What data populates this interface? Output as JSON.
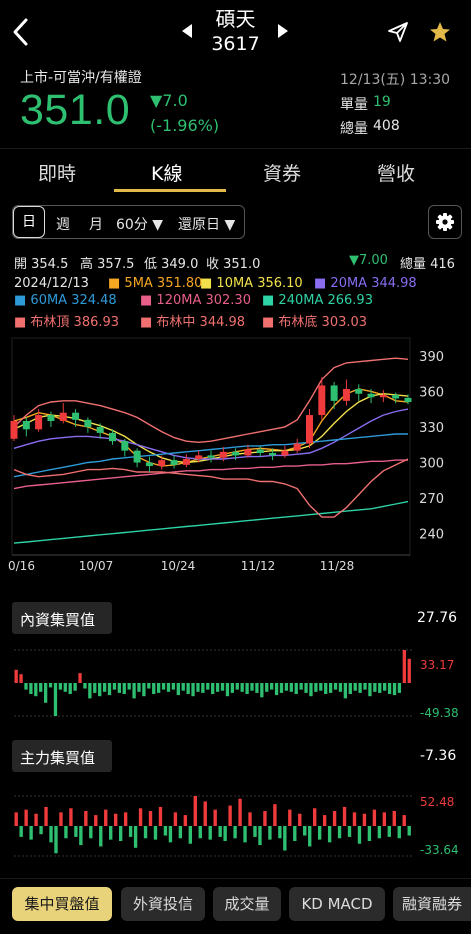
{
  "header": {
    "stock_name": "碩天",
    "stock_code": "3617",
    "market_info": "上市-可當沖/有權證",
    "price": "351.0",
    "change": "▼7.0",
    "change_pct": "(-1.96%)",
    "datetime": "12/13(五) 13:30",
    "unit_volume_label": "單量",
    "unit_volume": "19",
    "total_volume_label": "總量",
    "total_volume": "408"
  },
  "tabs": [
    "即時",
    "K線",
    "資券",
    "營收"
  ],
  "active_tab": "K線",
  "periods": {
    "day": "日",
    "week": "週",
    "month": "月",
    "minute": "60分 ▼",
    "restore": "還原日 ▼"
  },
  "ohlc": {
    "open": "開 354.5",
    "high": "高 357.5",
    "low": "低 349.0",
    "close": "收 351.0",
    "change": "▼7.00",
    "volume": "總量 416"
  },
  "legend": {
    "date": "2024/12/13",
    "ma5": "5MA 351.80",
    "ma10": "10MA 356.10",
    "ma20": "20MA 344.98",
    "ma60": "60MA 324.48",
    "ma120": "120MA 302.30",
    "ma240": "240MA 266.93",
    "bb_upper": "布林頂 386.93",
    "bb_mid": "布林中 344.98",
    "bb_lower": "布林底 303.03"
  },
  "colors": {
    "ma5": "#f5a623",
    "ma10": "#f2e14a",
    "ma20": "#8a6df0",
    "ma60": "#2e9ad8",
    "ma120": "#e8608a",
    "ma240": "#2ed3a6",
    "bb": "#f07070",
    "up": "#ef3b3b",
    "down": "#2fbf71",
    "accent": "#e3b94a"
  },
  "chart_data": {
    "type": "line",
    "y_ticks": [
      390,
      360,
      330,
      300,
      270,
      240
    ],
    "ylim": [
      222,
      405
    ],
    "x_ticks": [
      "0/16",
      "10/07",
      "10/24",
      "11/12",
      "11/28"
    ],
    "series": [
      {
        "name": "5MA",
        "values": [
          335,
          338,
          342,
          340,
          336,
          332,
          330,
          326,
          322,
          315,
          305,
          300,
          297,
          298,
          300,
          303,
          305,
          307,
          309,
          311,
          312,
          311,
          310,
          313,
          318,
          335,
          348,
          358,
          362,
          360,
          357,
          352,
          351
        ]
      },
      {
        "name": "10MA",
        "values": [
          328,
          333,
          338,
          340,
          339,
          337,
          334,
          331,
          327,
          322,
          315,
          309,
          304,
          301,
          300,
          301,
          303,
          305,
          307,
          308,
          309,
          310,
          310,
          311,
          314,
          322,
          333,
          343,
          351,
          356,
          358,
          357,
          356
        ]
      },
      {
        "name": "20MA",
        "values": [
          312,
          315,
          318,
          320,
          321,
          322,
          322,
          321,
          320,
          318,
          315,
          312,
          309,
          306,
          304,
          303,
          303,
          303,
          304,
          305,
          305,
          306,
          306,
          307,
          308,
          312,
          317,
          323,
          329,
          335,
          340,
          343,
          345
        ]
      },
      {
        "name": "60MA",
        "values": [
          288,
          290,
          292,
          294,
          296,
          298,
          300,
          301,
          303,
          304,
          305,
          306,
          307,
          308,
          309,
          310,
          311,
          312,
          313,
          314,
          314,
          315,
          315,
          316,
          317,
          318,
          319,
          320,
          321,
          322,
          323,
          324,
          324
        ]
      },
      {
        "name": "120MA",
        "values": [
          278,
          280,
          281,
          282,
          283,
          284,
          285,
          286,
          287,
          288,
          289,
          290,
          291,
          292,
          293,
          293,
          294,
          294,
          295,
          295,
          296,
          296,
          297,
          297,
          298,
          298,
          299,
          299,
          300,
          301,
          301,
          302,
          302
        ]
      },
      {
        "name": "240MA",
        "values": [
          232,
          233,
          234,
          235,
          236,
          237,
          238,
          239,
          240,
          241,
          242,
          243,
          244,
          245,
          246,
          247,
          248,
          249,
          250,
          251,
          252,
          253,
          254,
          255,
          256,
          257,
          258,
          259,
          260,
          261,
          263,
          265,
          267
        ]
      },
      {
        "name": "布林頂",
        "values": [
          330,
          340,
          348,
          351,
          352,
          352,
          350,
          348,
          345,
          342,
          338,
          332,
          326,
          321,
          318,
          317,
          318,
          320,
          322,
          324,
          326,
          328,
          330,
          336,
          352,
          370,
          380,
          384,
          385,
          386,
          387,
          388,
          387
        ]
      },
      {
        "name": "布林中",
        "values": [
          312,
          315,
          318,
          320,
          321,
          322,
          322,
          321,
          320,
          318,
          315,
          312,
          309,
          306,
          304,
          303,
          303,
          303,
          304,
          305,
          305,
          306,
          306,
          307,
          308,
          312,
          317,
          323,
          329,
          335,
          340,
          343,
          345
        ]
      },
      {
        "name": "布林底",
        "values": [
          294,
          290,
          288,
          289,
          290,
          292,
          294,
          294,
          295,
          294,
          292,
          292,
          292,
          291,
          290,
          289,
          288,
          286,
          286,
          286,
          284,
          284,
          282,
          278,
          264,
          254,
          254,
          262,
          273,
          284,
          293,
          298,
          303
        ]
      }
    ],
    "candles": [
      [
        320,
        335,
        340,
        318
      ],
      [
        335,
        328,
        338,
        322
      ],
      [
        328,
        340,
        345,
        326
      ],
      [
        340,
        335,
        343,
        330
      ],
      [
        335,
        342,
        350,
        333
      ],
      [
        342,
        336,
        345,
        330
      ],
      [
        336,
        330,
        338,
        325
      ],
      [
        330,
        325,
        333,
        320
      ],
      [
        325,
        318,
        328,
        315
      ],
      [
        318,
        310,
        320,
        305
      ],
      [
        310,
        300,
        312,
        296
      ],
      [
        300,
        297,
        305,
        292
      ],
      [
        297,
        302,
        306,
        294
      ],
      [
        302,
        298,
        306,
        295
      ],
      [
        298,
        303,
        307,
        296
      ],
      [
        303,
        306,
        310,
        300
      ],
      [
        306,
        304,
        310,
        300
      ],
      [
        304,
        309,
        313,
        301
      ],
      [
        309,
        306,
        312,
        302
      ],
      [
        306,
        311,
        315,
        304
      ],
      [
        311,
        308,
        314,
        305
      ],
      [
        308,
        306,
        312,
        302
      ],
      [
        306,
        310,
        314,
        304
      ],
      [
        310,
        316,
        320,
        308
      ],
      [
        316,
        340,
        345,
        312
      ],
      [
        340,
        365,
        372,
        336
      ],
      [
        365,
        352,
        368,
        345
      ],
      [
        352,
        362,
        370,
        348
      ],
      [
        362,
        358,
        366,
        352
      ],
      [
        358,
        355,
        362,
        350
      ],
      [
        355,
        357,
        361,
        351
      ],
      [
        357,
        354,
        359,
        350
      ],
      [
        354.5,
        351,
        357.5,
        349
      ]
    ]
  },
  "sections": {
    "domestic": {
      "title": "內資集買值",
      "value": "27.76",
      "max_label": "33.17",
      "min_label": "-49.38",
      "values": [
        12,
        8,
        -6,
        -10,
        -12,
        -8,
        -18,
        -4,
        -30,
        -6,
        -8,
        -10,
        -7,
        9,
        -5,
        -14,
        -9,
        -12,
        -8,
        -11,
        -6,
        -9,
        -10,
        -6,
        -14,
        -8,
        -12,
        -5,
        -10,
        -9,
        -6,
        -8,
        -6,
        -11,
        -7,
        -10,
        -12,
        -8,
        -9,
        -6,
        -10,
        -8,
        -7,
        -12,
        -9,
        -6,
        -8,
        -10,
        -7,
        -9,
        -13,
        -8,
        -6,
        -11,
        -9,
        -7,
        -8,
        -10,
        -6,
        -9,
        -12,
        -8,
        -7,
        -10,
        -9,
        -6,
        -8,
        -14,
        -10,
        -7,
        -9,
        -6,
        -12,
        -8,
        -9,
        -7,
        -10,
        -11,
        -9,
        30,
        22
      ]
    },
    "main_force": {
      "title": "主力集買值",
      "value": "-7.36",
      "max_label": "52.48",
      "min_label": "-33.64",
      "values": [
        10,
        -8,
        12,
        -10,
        9,
        -6,
        14,
        -12,
        -20,
        10,
        -9,
        13,
        -8,
        -14,
        11,
        -9,
        8,
        -15,
        12,
        -10,
        9,
        -11,
        10,
        -8,
        -16,
        13,
        -9,
        11,
        -10,
        14,
        -7,
        -12,
        10,
        -9,
        8,
        -13,
        22,
        -9,
        18,
        -10,
        12,
        -8,
        -11,
        15,
        -9,
        20,
        -12,
        10,
        -8,
        -14,
        11,
        -10,
        16,
        -9,
        -18,
        12,
        -11,
        9,
        -7,
        -15,
        13,
        -10,
        8,
        -12,
        11,
        -9,
        14,
        -8,
        10,
        -13,
        9,
        -11,
        12,
        -9,
        10,
        -8,
        11,
        -9,
        8,
        -7
      ]
    }
  },
  "bottom_tabs": [
    "集中買盤值",
    "外資投信",
    "成交量",
    "KD MACD",
    "融資融券"
  ],
  "active_bottom_tab": "集中買盤值"
}
